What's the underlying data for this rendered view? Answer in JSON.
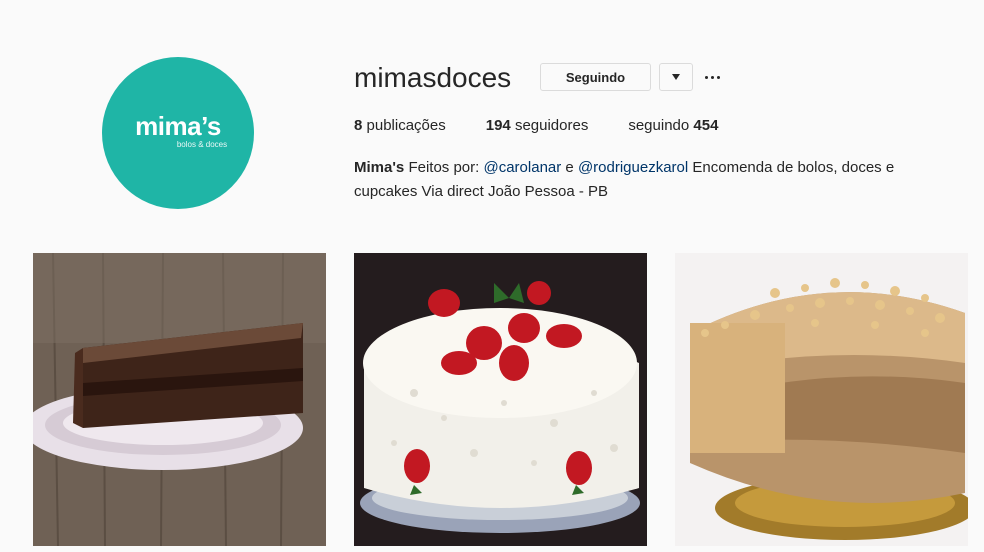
{
  "profile": {
    "avatar": {
      "brand": "mima’s",
      "tagline": "bolos & doces",
      "color": "#1fb5a6"
    },
    "username": "mimasdoces",
    "follow_button": "Seguindo",
    "dropdown_icon": "chevron-down-icon",
    "more_icon": "ellipsis-icon",
    "stats": {
      "posts_count": "8",
      "posts_label": "publicações",
      "followers_count": "194",
      "followers_label": "seguidores",
      "following_label": "seguindo",
      "following_count": "454"
    },
    "bio": {
      "name": "Mima's",
      "text1": "Feitos por:",
      "mention1": "@carolanar",
      "text2": "e",
      "mention2": "@rodriguezkarol",
      "text3": "Encomenda de bolos, doces e cupcakes Via direct João Pessoa - PB"
    }
  },
  "posts": [
    {
      "subject": "chocolate-cake-slice"
    },
    {
      "subject": "strawberry-cream-cake"
    },
    {
      "subject": "caramel-peanut-cake"
    }
  ],
  "colors": {
    "mention": "#003569",
    "text": "#262626",
    "border": "#dbdbdb",
    "background": "#fafafa"
  }
}
